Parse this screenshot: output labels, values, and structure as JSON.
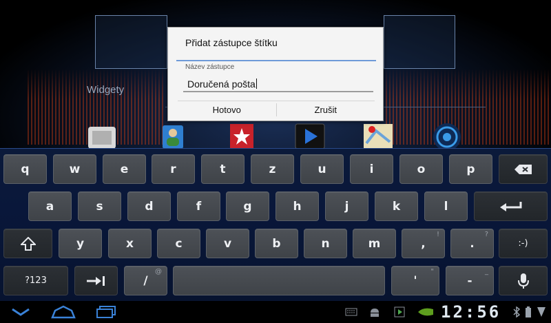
{
  "background": {
    "widgets_label": "Widgety"
  },
  "dialog": {
    "title": "Přidat zástupce štítku",
    "field_label": "Název zástupce",
    "field_value": "Doručená pošta",
    "ok_label": "Hotovo",
    "cancel_label": "Zrušit"
  },
  "keyboard": {
    "row1": [
      "q",
      "w",
      "e",
      "r",
      "t",
      "z",
      "u",
      "i",
      "o",
      "p"
    ],
    "row2": [
      "a",
      "s",
      "d",
      "f",
      "g",
      "h",
      "j",
      "k",
      "l"
    ],
    "row3": [
      "y",
      "x",
      "c",
      "v",
      "b",
      "n",
      "m"
    ],
    "comma": ",",
    "comma_hint": "!",
    "period": ".",
    "period_hint": "?",
    "smiley": ":-)",
    "symbols": "?123",
    "slash": "/",
    "slash_hint": "@",
    "apostrophe": "'",
    "apostrophe_hint": "\"",
    "dash": "-",
    "dash_hint": "_"
  },
  "status_bar": {
    "clock": "12:56"
  },
  "colors": {
    "accent_blue": "#6e9ad8",
    "key_bg": "#4a4e54",
    "keyboard_bg": "#0b1a3a"
  }
}
